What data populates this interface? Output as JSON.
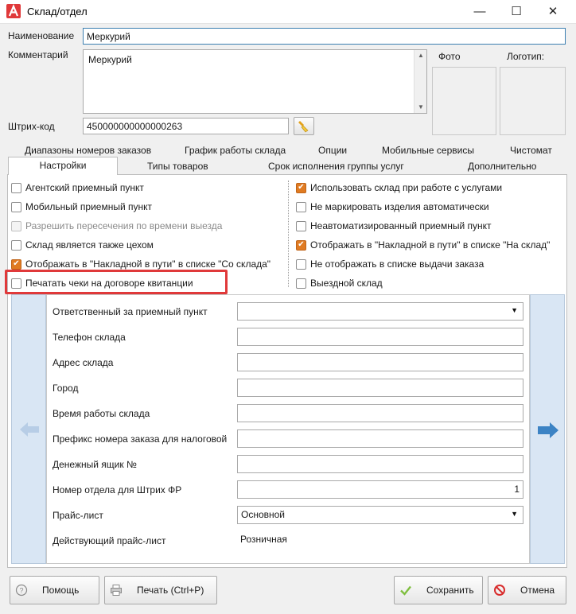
{
  "window": {
    "title": "Склад/отдел",
    "minimize_glyph": "—",
    "maximize_glyph": "☐",
    "close_glyph": "✕"
  },
  "form": {
    "name_label": "Наименование",
    "name_value": "Меркурий",
    "comment_label": "Комментарий",
    "comment_value": "Меркурий",
    "barcode_label": "Штрих-код",
    "barcode_value": "450000000000000263",
    "photo_label": "Фото",
    "logo_label": "Логотип:"
  },
  "tabs_row1": [
    "Диапазоны номеров заказов",
    "График работы склада",
    "Опции",
    "Мобильные сервисы",
    "Чистомат"
  ],
  "tabs_row2": [
    "Настройки",
    "Типы товаров",
    "Срок исполнения группы услуг",
    "Дополнительно"
  ],
  "checkboxes_left": [
    {
      "label": "Агентский приемный пункт",
      "checked": false,
      "disabled": false
    },
    {
      "label": "Мобильный приемный пункт",
      "checked": false,
      "disabled": false
    },
    {
      "label": "Разрешить пересечения по времени выезда",
      "checked": false,
      "disabled": true
    },
    {
      "label": "Склад является также цехом",
      "checked": false,
      "disabled": false
    },
    {
      "label": "Отображать в \"Накладной в пути\" в списке \"Со склада\"",
      "checked": true,
      "disabled": false
    },
    {
      "label": "Печатать чеки на договоре квитанции",
      "checked": false,
      "disabled": false
    }
  ],
  "checkboxes_right": [
    {
      "label": "Использовать склад при работе с услугами",
      "checked": true
    },
    {
      "label": "Не маркировать изделия автоматически",
      "checked": false
    },
    {
      "label": "Неавтоматизированный приемный пункт",
      "checked": false
    },
    {
      "label": "Отображать в \"Накладной в пути\" в списке \"На склад\"",
      "checked": true
    },
    {
      "label": "Не отображать в списке выдачи заказа",
      "checked": false
    },
    {
      "label": "Выездной склад",
      "checked": false
    }
  ],
  "panel_fields": [
    {
      "label": "Ответственный за приемный пункт",
      "value": "",
      "kind": "dropdown"
    },
    {
      "label": "Телефон склада",
      "value": "",
      "kind": "text"
    },
    {
      "label": "Адрес склада",
      "value": "",
      "kind": "text"
    },
    {
      "label": "Город",
      "value": "",
      "kind": "text"
    },
    {
      "label": "Время работы склада",
      "value": "",
      "kind": "text"
    },
    {
      "label": "Префикс номера заказа для налоговой",
      "value": "",
      "kind": "text"
    },
    {
      "label": "Денежный ящик №",
      "value": "",
      "kind": "text"
    },
    {
      "label": "Номер отдела для Штрих ФР",
      "value": "1",
      "kind": "number"
    },
    {
      "label": "Прайс-лист",
      "value": "Основной",
      "kind": "dropdown"
    },
    {
      "label": "Действующий прайс-лист",
      "value": "Розничная",
      "kind": "static"
    }
  ],
  "buttons": {
    "help": "Помощь",
    "print": "Печать (Ctrl+P)",
    "save": "Сохранить",
    "cancel": "Отмена"
  },
  "colors": {
    "accent_check": "#e07b22",
    "highlight": "#e0393a",
    "nav_arrow": "#3c83c4",
    "nav_panel": "#d9e6f4",
    "app_logo": "#e0393a"
  }
}
